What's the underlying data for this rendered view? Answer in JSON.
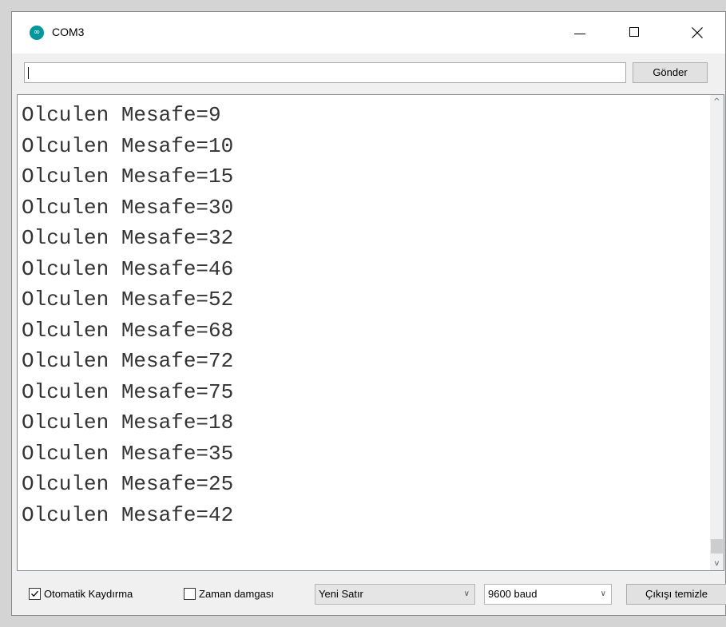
{
  "window": {
    "title": "COM3",
    "icon": "arduino-icon"
  },
  "send": {
    "input_value": "",
    "button_label": "Gönder"
  },
  "output": {
    "lines": [
      "Olculen Mesafe=9",
      "Olculen Mesafe=10",
      "Olculen Mesafe=15",
      "Olculen Mesafe=30",
      "Olculen Mesafe=32",
      "Olculen Mesafe=46",
      "Olculen Mesafe=52",
      "Olculen Mesafe=68",
      "Olculen Mesafe=72",
      "Olculen Mesafe=75",
      "Olculen Mesafe=18",
      "Olculen Mesafe=35",
      "Olculen Mesafe=25",
      "Olculen Mesafe=42"
    ]
  },
  "bottom": {
    "autoscroll": {
      "label": "Otomatik Kaydırma",
      "checked": true
    },
    "timestamp": {
      "label": "Zaman damgası",
      "checked": false
    },
    "line_ending": {
      "selected": "Yeni Satır"
    },
    "baud": {
      "selected": "9600 baud"
    },
    "clear_label": "Çıkışı temizle"
  }
}
